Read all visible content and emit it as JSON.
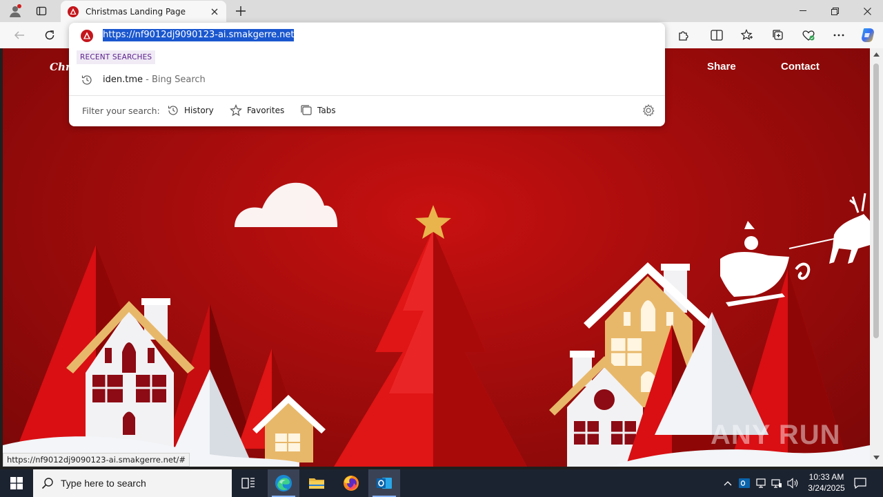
{
  "browser": {
    "tab_title": "Christmas Landing Page",
    "address_url": "https://nf9012dj9090123-ai.smakgerre.net",
    "status_url": "https://nf9012dj9090123-ai.smakgerre.net/#"
  },
  "omnibox": {
    "recent_label": "RECENT SEARCHES",
    "recent_items": [
      {
        "query": "iden.tme",
        "source": " - Bing Search"
      }
    ],
    "filter_label": "Filter your search:",
    "filters": [
      "History",
      "Favorites",
      "Tabs"
    ]
  },
  "page": {
    "logo": "Chri",
    "nav": [
      "Share",
      "Contact"
    ],
    "colors": {
      "bg": "#a30c0c",
      "tree": "#e01515",
      "house_gold": "#e8b86a",
      "snow": "#ffffff"
    }
  },
  "taskbar": {
    "search_placeholder": "Type here to search",
    "time": "10:33 AM",
    "date": "3/24/2025"
  },
  "watermark": "ANY RUN"
}
